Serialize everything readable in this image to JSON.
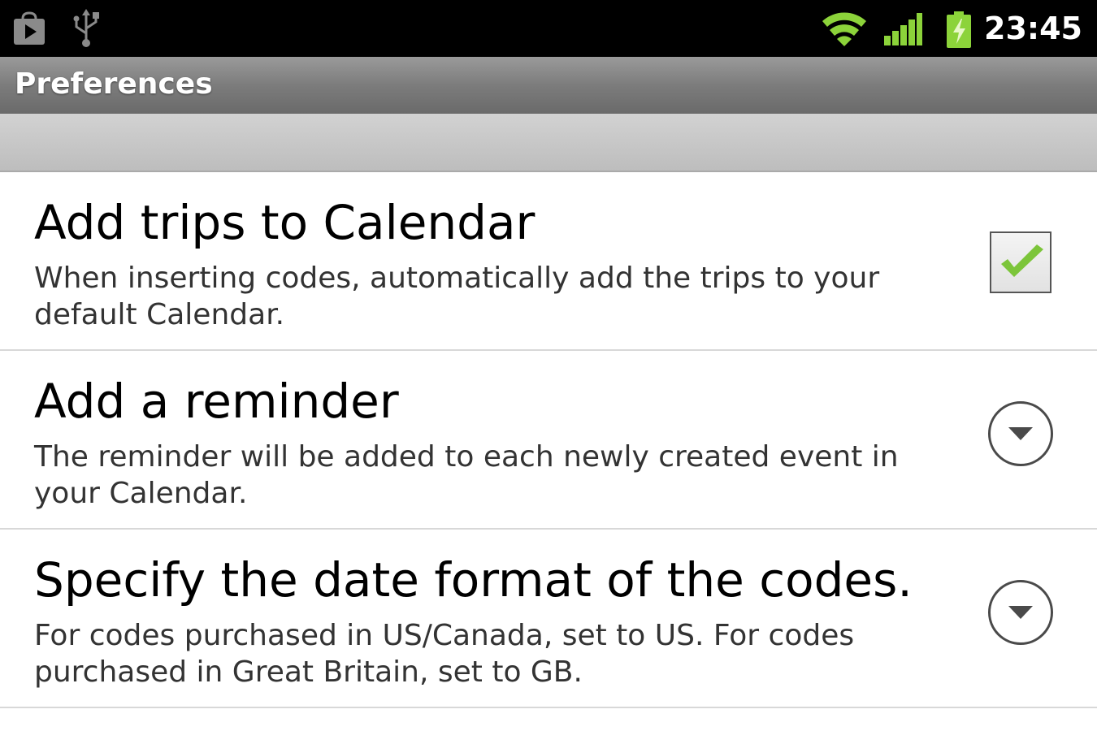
{
  "status_bar": {
    "left_icons": [
      "store-icon",
      "usb-icon"
    ],
    "right_icons": [
      "wifi-icon",
      "signal-icon",
      "battery-charging-icon"
    ],
    "time": "23:45",
    "accent_color": "#8cd33a"
  },
  "title_bar": {
    "title": "Preferences"
  },
  "preferences": [
    {
      "title": "Add trips to Calendar",
      "summary": "When inserting codes, automatically add the trips to your default Calendar.",
      "control": "checkbox",
      "checked": true
    },
    {
      "title": "Add a reminder",
      "summary": "The reminder will be added to each newly created event in your Calendar.",
      "control": "dropdown"
    },
    {
      "title": "Specify the date format of the codes.",
      "summary": "For codes purchased in US/Canada, set to US. For codes purchased in Great Britain, set to GB.",
      "control": "dropdown"
    }
  ]
}
